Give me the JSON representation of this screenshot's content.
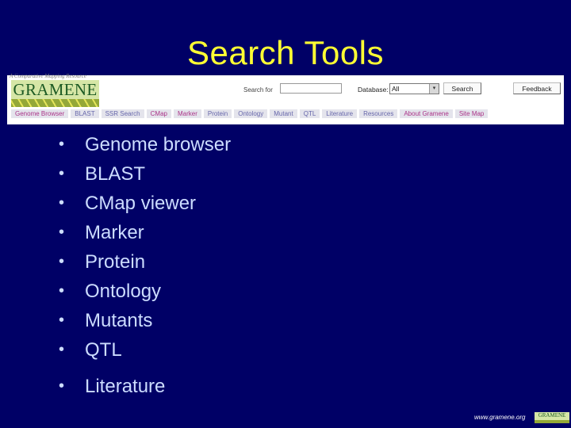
{
  "slide": {
    "title": "Search Tools",
    "bullets": [
      "Genome browser",
      "BLAST",
      "CMap viewer",
      "Marker",
      "Protein",
      "Ontology",
      "Mutants",
      "QTL",
      "Literature"
    ],
    "bullet_glyph": "•",
    "footer_url": "www.gramene.org",
    "colors": {
      "background": "#000066",
      "title": "#ffff33",
      "bullet_text": "#ccdcff"
    }
  },
  "website": {
    "tagline": "A Comparative Mapping Resource",
    "logo_text": "GRAMENE",
    "search_label": "Search for",
    "search_value": "",
    "database_label": "Database:",
    "database_selected": "All",
    "dropdown_arrow": "▾",
    "search_button": "Search",
    "feedback_button": "Feedback",
    "nav_tabs": [
      {
        "label": "Genome Browser",
        "tone": "pink"
      },
      {
        "label": "BLAST",
        "tone": "blue"
      },
      {
        "label": "SSR Search",
        "tone": "blue"
      },
      {
        "label": "CMap",
        "tone": "pink"
      },
      {
        "label": "Marker",
        "tone": "pink"
      },
      {
        "label": "Protein",
        "tone": "blue"
      },
      {
        "label": "Ontology",
        "tone": "blue"
      },
      {
        "label": "Mutant",
        "tone": "blue"
      },
      {
        "label": "QTL",
        "tone": "blue"
      },
      {
        "label": "Literature",
        "tone": "blue"
      },
      {
        "label": "Resources",
        "tone": "blue"
      },
      {
        "label": "About Gramene",
        "tone": "pink"
      },
      {
        "label": "Site Map",
        "tone": "pink"
      }
    ]
  },
  "footer_logo_text": "GRAMENE"
}
